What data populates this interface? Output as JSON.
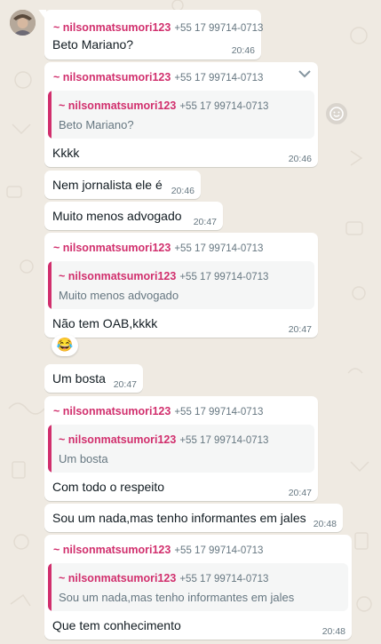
{
  "chat": {
    "sender_name": "~ nilsonmatsumori123",
    "sender_phone": "+55 17 99714-0713",
    "messages": [
      {
        "text": "Beto Mariano?",
        "time": "20:46"
      },
      {
        "quote": "Beto Mariano?",
        "text": "Kkkk",
        "time": "20:46"
      },
      {
        "text": "Nem jornalista ele é",
        "time": "20:46"
      },
      {
        "text": "Muito menos advogado",
        "time": "20:47"
      },
      {
        "quote": "Muito menos advogado",
        "text": "Não tem OAB,kkkk",
        "time": "20:47",
        "reaction": "😂"
      },
      {
        "text": "Um bosta",
        "time": "20:47"
      },
      {
        "quote": "Um bosta",
        "text": "Com todo o respeito",
        "time": "20:47"
      },
      {
        "text": "Sou um nada,mas tenho informantes em jales",
        "time": "20:48"
      },
      {
        "quote": "Sou um nada,mas tenho informantes em jales",
        "text": "Que tem conhecimento",
        "time": "20:48"
      }
    ]
  },
  "icons": {
    "menu": "chevron-down-icon",
    "react": "smiley-icon",
    "avatar": "user-avatar"
  },
  "colors": {
    "background": "#efeae2",
    "bubble": "#ffffff",
    "sender": "#d12f6d",
    "meta": "#667781",
    "quote_bg": "#f5f6f6"
  }
}
